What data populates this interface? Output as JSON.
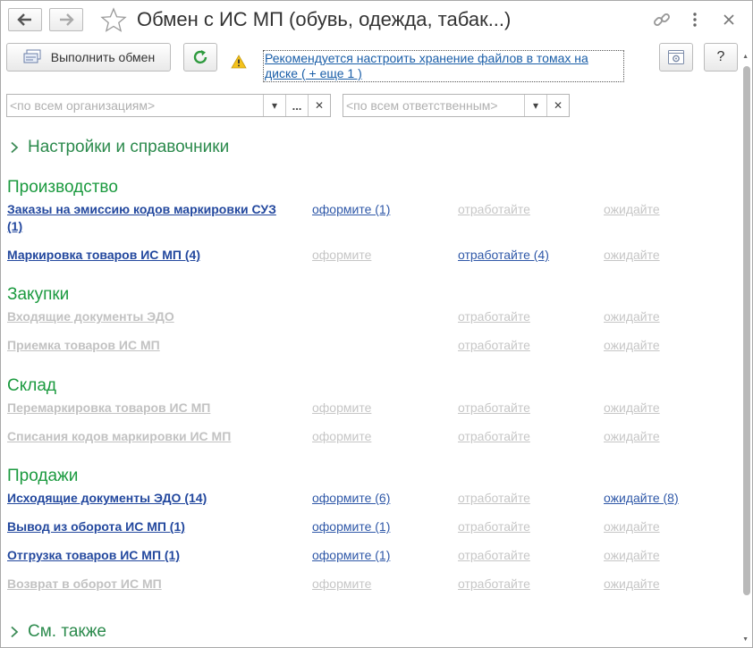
{
  "window": {
    "title": "Обмен с ИС МП (обувь, одежда, табак...)",
    "back_icon": "arrow-left-icon",
    "forward_icon": "arrow-right-icon",
    "favorite_icon": "star-icon",
    "link_icon": "link-icon",
    "more_icon": "more-vertical-icon",
    "close_icon": "close-icon"
  },
  "toolbar": {
    "exchange_label": "Выполнить обмен",
    "refresh_icon": "refresh-icon",
    "warning_icon": "warning-icon",
    "notice_text": "Рекомендуется настроить хранение файлов в томах на диске ( + еще 1 )",
    "settings_icon": "settings-icon",
    "help_label": "?"
  },
  "filters": {
    "organizations_placeholder": "<по всем организациям>",
    "responsible_placeholder": "<по всем ответственным>",
    "select_label": "...",
    "clear_label": "✕",
    "dropdown_label": "▾"
  },
  "settings_group": {
    "label": "Настройки и справочники"
  },
  "see_also": {
    "label": "См. также"
  },
  "sections": {
    "production": {
      "title": "Производство",
      "rows": [
        {
          "name": "Заказы на эмиссию кодов маркировки СУЗ (1)",
          "a1": "оформите (1)",
          "a2": "отработайте",
          "a3": "ожидайте"
        },
        {
          "name": "Маркировка товаров ИС МП (4)",
          "a1": "оформите",
          "a2": "отработайте (4)",
          "a3": "ожидайте"
        }
      ]
    },
    "purchases": {
      "title": "Закупки",
      "rows": [
        {
          "name": "Входящие документы ЭДО",
          "a2": "отработайте",
          "a3": "ожидайте"
        },
        {
          "name": "Приемка товаров ИС МП",
          "a2": "отработайте",
          "a3": "ожидайте"
        }
      ]
    },
    "warehouse": {
      "title": "Склад",
      "rows": [
        {
          "name": "Перемаркировка товаров ИС МП",
          "a1": "оформите",
          "a2": "отработайте",
          "a3": "ожидайте"
        },
        {
          "name": "Списания кодов маркировки ИС МП",
          "a1": "оформите",
          "a2": "отработайте",
          "a3": "ожидайте"
        }
      ]
    },
    "sales": {
      "title": "Продажи",
      "rows": [
        {
          "name": "Исходящие документы ЭДО (14)",
          "a1": "оформите (6)",
          "a2": "отработайте",
          "a3": "ожидайте (8)"
        },
        {
          "name": "Вывод из оборота ИС МП (1)",
          "a1": "оформите (1)",
          "a2": "отработайте",
          "a3": "ожидайте"
        },
        {
          "name": "Отгрузка товаров ИС МП (1)",
          "a1": "оформите (1)",
          "a2": "отработайте",
          "a3": "ожидайте"
        },
        {
          "name": "Возврат в оборот ИС МП",
          "a1": "оформите",
          "a2": "отработайте",
          "a3": "ожидайте"
        }
      ]
    }
  },
  "colors": {
    "section_title": "#1b9a3f",
    "active_link": "#23489e",
    "inactive_link": "#c2c2c2"
  }
}
